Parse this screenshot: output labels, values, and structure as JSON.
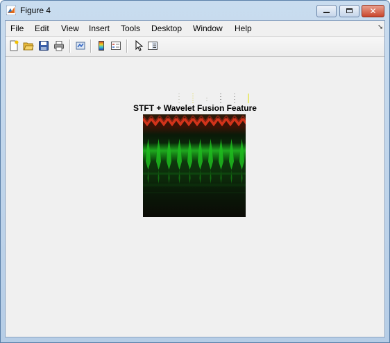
{
  "window": {
    "title": "Figure 4",
    "controls": [
      "minimize",
      "maximize",
      "close"
    ],
    "close_glyph": "✕"
  },
  "menu": {
    "items": [
      "File",
      "Edit",
      "View",
      "Insert",
      "Tools",
      "Desktop",
      "Window",
      "Help"
    ]
  },
  "toolbar": {
    "buttons": [
      "new-figure-icon",
      "open-file-icon",
      "save-icon",
      "print-icon",
      "link-plot-icon",
      "insert-colorbar-icon",
      "insert-legend-icon",
      "select-arrow-icon",
      "show-plot-tools-icon"
    ]
  },
  "figure": {
    "title": "STFT + Wavelet Fusion Feature"
  },
  "colors": {
    "accent": "#c9462c",
    "image_red": "#c02a10",
    "image_green": "#1fa81f",
    "image_dark": "#0b0b06"
  }
}
